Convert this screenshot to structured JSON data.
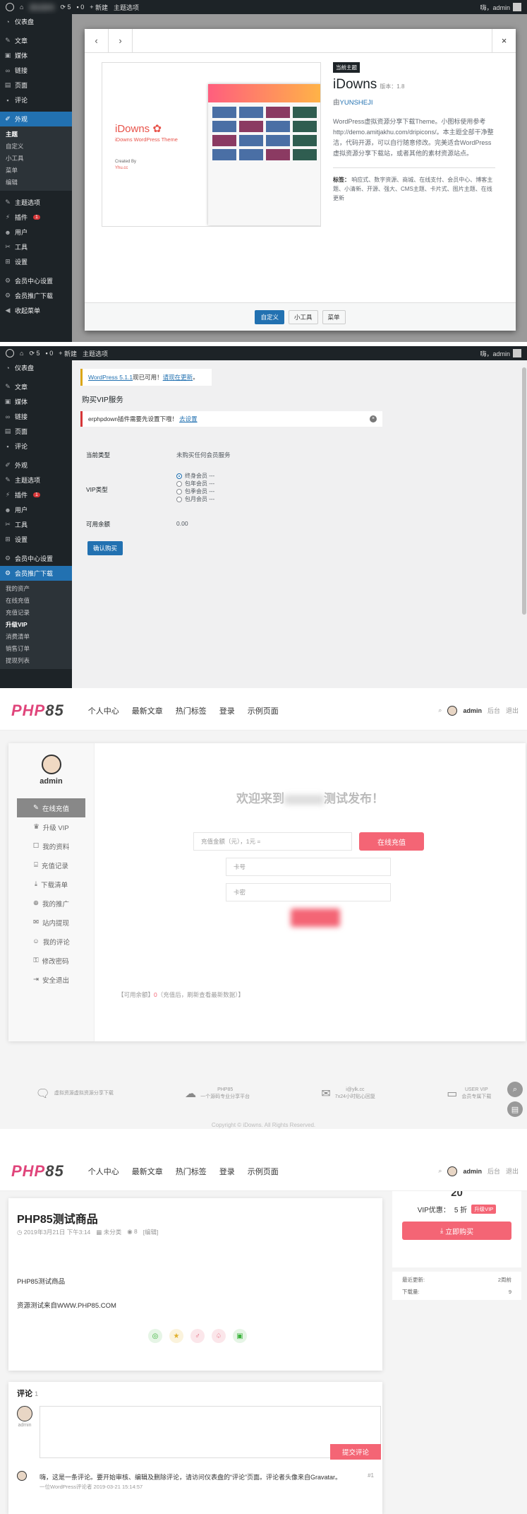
{
  "panel1": {
    "adminbar": {
      "site": "测试发布",
      "updates": "5",
      "comments": "0",
      "new": "新建",
      "theme_options": "主题选项",
      "greeting": "嗨，admin"
    },
    "menu": [
      {
        "icon": "dashboard-icon",
        "label": "仪表盘"
      },
      {
        "icon": "pin-icon",
        "label": "文章"
      },
      {
        "icon": "media-icon",
        "label": "媒体"
      },
      {
        "icon": "link-icon",
        "label": "链接"
      },
      {
        "icon": "page-icon",
        "label": "页面"
      },
      {
        "icon": "comment-icon",
        "label": "评论"
      }
    ],
    "appearance": "外观",
    "sub": [
      "主题",
      "自定义",
      "小工具",
      "菜单",
      "编辑"
    ],
    "menu2": [
      {
        "icon": "theme-options-icon",
        "label": "主题选项"
      },
      {
        "icon": "plugin-icon",
        "label": "插件",
        "badge": "1"
      },
      {
        "icon": "user-icon",
        "label": "用户"
      },
      {
        "icon": "tool-icon",
        "label": "工具"
      },
      {
        "icon": "settings-icon",
        "label": "设置"
      }
    ],
    "menu3": [
      {
        "icon": "member-icon",
        "label": "会员中心设置"
      },
      {
        "icon": "promo-icon",
        "label": "会员推广下载"
      },
      {
        "icon": "collapse-icon",
        "label": "收起菜单"
      }
    ],
    "modal": {
      "prev": "‹",
      "next": "›",
      "close": "×",
      "shot_title": "iDowns ✿",
      "shot_sub": "iDowns WordPress Theme",
      "shot_by": "Created By",
      "shot_by2": "Yhu.cc",
      "current": "当前主题",
      "name": "iDowns",
      "version": "版本：1.8",
      "author_prefix": "由",
      "author": "YUNSHEJI",
      "desc": "WordPress虚拟资源分享下载Theme。小图标使用参考http://demo.amitjakhu.com/dripicons/。本主题全部干净整洁，代码开源，可以自行随意修改。完美适合WordPress虚拟资源分享下载站，或者其他的素材资源站点。",
      "tags_label": "标签：",
      "tags": "响应式、数字资源、商城、在线支付、会员中心、博客主题、小清新、开源、强大、CMS主题、卡片式、图片主题、在线更新",
      "btn_customize": "自定义",
      "btn_widgets": "小工具",
      "btn_menus": "菜单"
    }
  },
  "panel2": {
    "adminbar": {
      "updates": "5",
      "comments": "0",
      "new": "新建",
      "theme_options": "主题选项",
      "greeting": "嗨，admin"
    },
    "menu": [
      {
        "icon": "dashboard-icon",
        "label": "仪表盘"
      },
      {
        "icon": "pin-icon",
        "label": "文章"
      },
      {
        "icon": "media-icon",
        "label": "媒体"
      },
      {
        "icon": "link-icon",
        "label": "链接"
      },
      {
        "icon": "page-icon",
        "label": "页面"
      },
      {
        "icon": "comment-icon",
        "label": "评论"
      },
      {
        "icon": "appearance-icon",
        "label": "外观"
      },
      {
        "icon": "theme-options-icon",
        "label": "主题选项"
      },
      {
        "icon": "plugin-icon",
        "label": "插件",
        "badge": "1"
      },
      {
        "icon": "user-icon",
        "label": "用户"
      },
      {
        "icon": "tool-icon",
        "label": "工具"
      },
      {
        "icon": "settings-icon",
        "label": "设置"
      },
      {
        "icon": "member-icon",
        "label": "会员中心设置"
      }
    ],
    "active": "会员推广下载",
    "sub": [
      "我的资产",
      "在线充值",
      "充值记录",
      "升级VIP",
      "消费清单",
      "销售订单",
      "提现列表"
    ],
    "notice_link": "WordPress 5.1.1",
    "notice_mid": "现已可用！",
    "notice_update": "请现在更新",
    "notice_end": "。",
    "heading": "购买VIP服务",
    "error_text": "erphpdown插件需要先设置下哦！",
    "error_link": "去设置",
    "current_type_label": "当前类型",
    "current_type_value": "未购买任何会员服务",
    "vip_type_label": "VIP类型",
    "vip_options": [
      "终身会员 ---",
      "包年会员 ---",
      "包季会员 ---",
      "包月会员 ---"
    ],
    "balance_label": "可用余额",
    "balance_value": "0.00",
    "confirm": "确认购买"
  },
  "panel3": {
    "logo_a": "PHP",
    "logo_b": "85",
    "nav": [
      "个人中心",
      "最新文章",
      "热门标签",
      "登录",
      "示例页面"
    ],
    "user": "admin",
    "backend": "后台",
    "logout": "退出",
    "uname": "admin",
    "umenu": [
      {
        "icon": "✎",
        "label": "在线充值"
      },
      {
        "icon": "♛",
        "label": "升级 VIP"
      },
      {
        "icon": "☐",
        "label": "我的资料"
      },
      {
        "icon": "⌸",
        "label": "充值记录"
      },
      {
        "icon": "⤓",
        "label": "下载清单"
      },
      {
        "icon": "⊕",
        "label": "我的推广"
      },
      {
        "icon": "✉",
        "label": "站内提现"
      },
      {
        "icon": "☺",
        "label": "我的评论"
      },
      {
        "icon": "⚿",
        "label": "修改密码"
      },
      {
        "icon": "⇥",
        "label": "安全退出"
      }
    ],
    "welcome_a": "欢迎来到",
    "welcome_b": "测试发布！",
    "amount_placeholder": "充值金额（元），1元 =",
    "recharge_btn": "在线充值",
    "card_no": "卡号",
    "card_pwd": "卡密",
    "note_a": "【可用余额】",
    "note_b": "0",
    "note_c": "（充值后，刷新查看最新数据）】",
    "footer": [
      {
        "icon": "chat-icon",
        "line1": "虚拟资源虚拟资源分享下载",
        "line2": ""
      },
      {
        "icon": "cloud-icon",
        "line1": "PHP85",
        "line2": "一个源码专业分享平台"
      },
      {
        "icon": "mail-icon",
        "line1": "i@ylk.cc",
        "line2": "7x24小时贴心回复"
      },
      {
        "icon": "card-icon",
        "line1": "USER VIP",
        "line2": "会员专属下载"
      }
    ],
    "copyright": "Copyright © iDowns. All Rights Reserved."
  },
  "panel4": {
    "logo_a": "PHP",
    "logo_b": "85",
    "nav": [
      "个人中心",
      "最新文章",
      "热门标签",
      "登录",
      "示例页面"
    ],
    "user": "admin",
    "backend": "后台",
    "logout": "退出",
    "title": "PHP85测试商品",
    "date": "2019年3月21日 下午3:14",
    "category": "未分类",
    "views": "8",
    "edit": "[编辑]",
    "body1": "PHP85测试商品",
    "body2": "资源测试来自WWW.PHP85.COM",
    "price_top": "20",
    "vip_label": "VIP优惠：",
    "vip_value": "5 折",
    "vip_tag": "升级VIP",
    "buy": "立即购买",
    "last_update_label": "最近更新:",
    "last_update_value": "2周前",
    "downloads_label": "下载量:",
    "downloads_value": "9",
    "comments_title": "评论",
    "comments_count": "1",
    "avatar_name": "admin",
    "submit": "提交评论",
    "c1_text": "嗨，这是一条评论。要开始审核、编辑及删除评论，请访问仪表盘的“评论”页面。评论者头像来自Gravatar。",
    "c1_meta": "一位WordPress评论者  2019-03-21 15:14:57",
    "c1_floor": "#1"
  }
}
